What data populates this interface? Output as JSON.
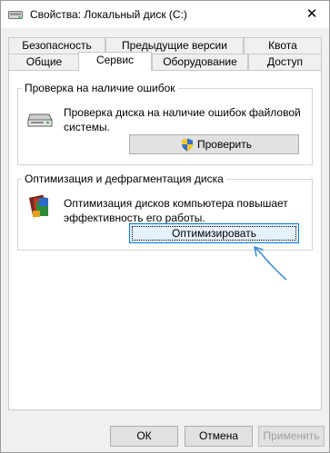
{
  "window": {
    "title": "Свойства: Локальный диск (C:)",
    "close_symbol": "✕"
  },
  "tabs_row1": [
    {
      "label": "Безопасность"
    },
    {
      "label": "Предыдущие версии"
    },
    {
      "label": "Квота"
    }
  ],
  "tabs_row2": [
    {
      "label": "Общие"
    },
    {
      "label": "Сервис",
      "active": true
    },
    {
      "label": "Оборудование"
    },
    {
      "label": "Доступ"
    }
  ],
  "error_check": {
    "title": "Проверка на наличие ошибок",
    "description": "Проверка диска на наличие ошибок файловой системы.",
    "button": "Проверить",
    "icon": "drive-icon"
  },
  "optimize": {
    "title": "Оптимизация и дефрагментация диска",
    "description": "Оптимизация дисков компьютера повышает эффективность его работы.",
    "button": "Оптимизировать",
    "icon": "defrag-icon"
  },
  "footer": {
    "ok": "ОК",
    "cancel": "Отмена",
    "apply": "Применить"
  },
  "colors": {
    "accent": "#0078d7",
    "annotation_arrow": "#3d8fd6"
  }
}
